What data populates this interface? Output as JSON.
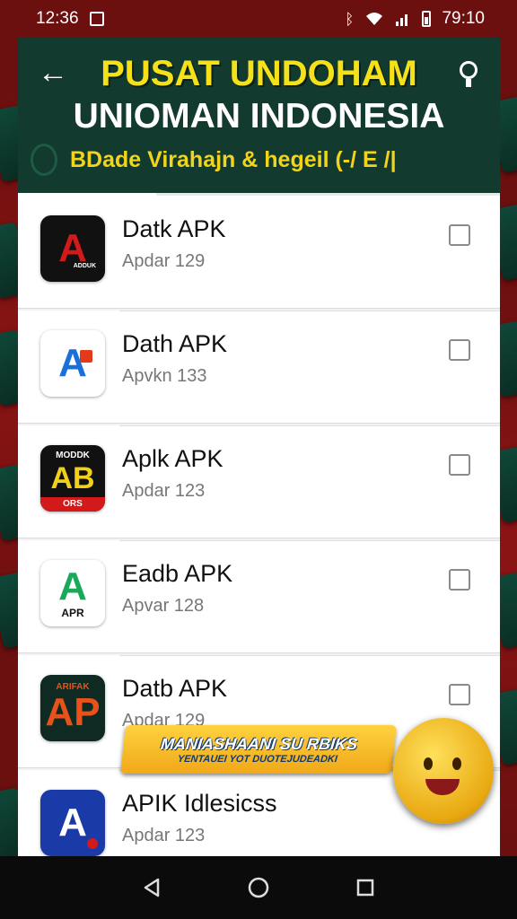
{
  "status_bar": {
    "time_left": "12:36",
    "time_right": "79:10"
  },
  "header": {
    "title_line1": "PUSAT UNDOHAM",
    "title_line2": "UNIOMAN INDONESIA",
    "subtitle": "BDade Virahajn & hegeil (-/ E /|"
  },
  "apps": [
    {
      "name": "Datk APK",
      "version": "Apdar 129",
      "checked": false,
      "icon": "red-a-logo",
      "icon_bg": "#111111",
      "icon_fg": "#d21a1a"
    },
    {
      "name": "Dath APK",
      "version": "Apvkn 133",
      "checked": false,
      "icon": "blue-a-logo",
      "icon_bg": "#ffffff",
      "icon_fg": "#1a6fd8"
    },
    {
      "name": "Aplk APK",
      "version": "Apdar 123",
      "checked": false,
      "icon": "ab-mod-logo",
      "icon_bg": "#111111",
      "icon_fg": "#f0d01a"
    },
    {
      "name": "Eadb APK",
      "version": "Apvar 128",
      "checked": false,
      "icon": "apk-a-logo",
      "icon_bg": "#ffffff",
      "icon_fg": "#1aa85a"
    },
    {
      "name": "Datb APK",
      "version": "Apdar 129",
      "checked": false,
      "icon": "ap-logo",
      "icon_bg": "#0f2a22",
      "icon_fg": "#e8521a"
    },
    {
      "name": "APIK Idlesicss",
      "version": "Apdar 123",
      "checked": false,
      "icon": "blue-a-logo",
      "icon_bg": "#1a3aa8",
      "icon_fg": "#ffffff"
    }
  ],
  "icon_labels": {
    "icon1_small": "ADDUK",
    "icon3_top": "MODDK",
    "icon3_bottom": "ORS",
    "icon4_bottom": "APR",
    "icon5_top": "ARIFAK"
  },
  "promo": {
    "line1": "MANIASHAANI SU RBIKS",
    "line2": "YENTAUEI YOT DUOTEJUDEADKI"
  },
  "colors": {
    "header_bg": "#123a2e",
    "title_yellow": "#f5e11a",
    "backdrop_red": "#6b0f0f"
  }
}
